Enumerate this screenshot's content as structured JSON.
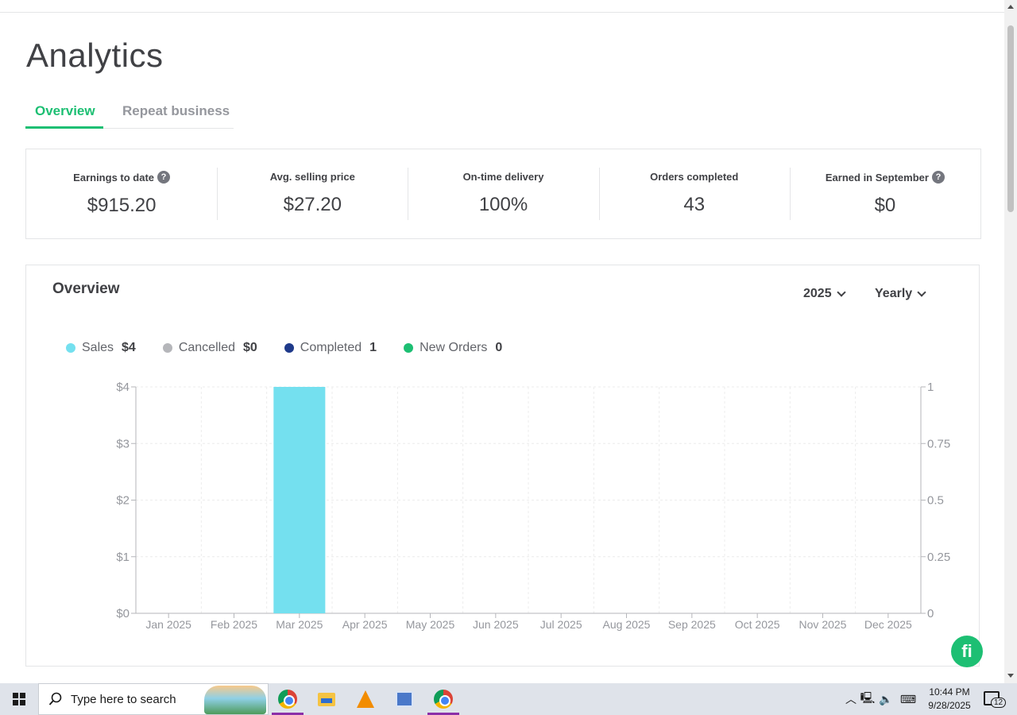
{
  "page": {
    "title": "Analytics",
    "tabs": [
      {
        "label": "Overview",
        "active": true
      },
      {
        "label": "Repeat business",
        "active": false
      }
    ]
  },
  "stats": [
    {
      "label": "Earnings to date",
      "value": "$915.20",
      "help": true
    },
    {
      "label": "Avg. selling price",
      "value": "$27.20",
      "help": false
    },
    {
      "label": "On-time delivery",
      "value": "100%",
      "help": false
    },
    {
      "label": "Orders completed",
      "value": "43",
      "help": false
    },
    {
      "label": "Earned in September",
      "value": "$0",
      "help": true
    }
  ],
  "overview": {
    "title": "Overview",
    "year_select": "2025",
    "period_select": "Yearly",
    "legend": [
      {
        "label": "Sales",
        "value": "$4",
        "color": "#74e0ef"
      },
      {
        "label": "Cancelled",
        "value": "$0",
        "color": "#b5b6ba"
      },
      {
        "label": "Completed",
        "value": "1",
        "color": "#1f3a8a"
      },
      {
        "label": "New Orders",
        "value": "0",
        "color": "#1dbf73"
      }
    ]
  },
  "chart_data": {
    "type": "bar",
    "categories": [
      "Jan 2025",
      "Feb 2025",
      "Mar 2025",
      "Apr 2025",
      "May 2025",
      "Jun 2025",
      "Jul 2025",
      "Aug 2025",
      "Sep 2025",
      "Oct 2025",
      "Nov 2025",
      "Dec 2025"
    ],
    "series": [
      {
        "name": "Sales",
        "values": [
          0,
          0,
          4,
          0,
          0,
          0,
          0,
          0,
          0,
          0,
          0,
          0
        ],
        "color": "#74e0ef",
        "axis": "left"
      }
    ],
    "left_axis": {
      "ticks": [
        "$0",
        "$1",
        "$2",
        "$3",
        "$4"
      ],
      "ylim": [
        0,
        4
      ]
    },
    "right_axis": {
      "ticks": [
        "0",
        "0.25",
        "0.5",
        "0.75",
        "1"
      ],
      "ylim": [
        0,
        1
      ]
    },
    "grid": true
  },
  "taskbar": {
    "search_placeholder": "Type here to search",
    "time": "10:44 PM",
    "date": "9/28/2025",
    "notification_count": "12"
  }
}
